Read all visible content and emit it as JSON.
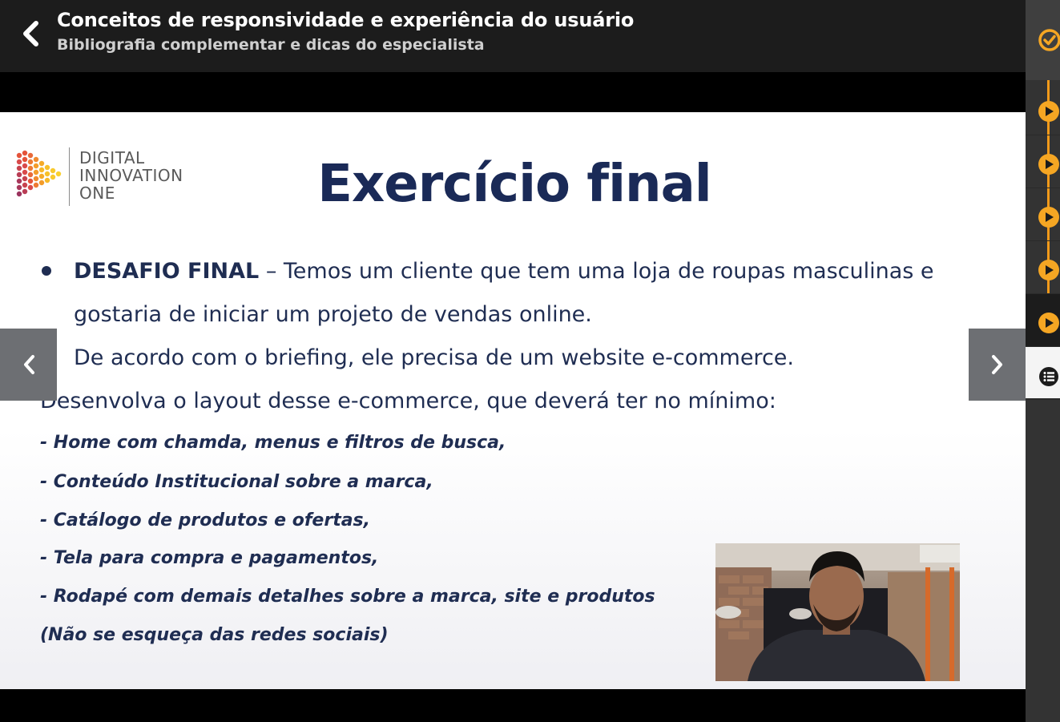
{
  "header": {
    "title": "Conceitos de responsividade e experiência do usuário",
    "subtitle": "Bibliografia complementar e dicas do especialista"
  },
  "slide": {
    "logo_lines": [
      "DIGITAL",
      "INNOVATION",
      "ONE"
    ],
    "title": "Exercício final",
    "bullet_bold": "DESAFIO FINAL",
    "bullet_rest": " – Temos um cliente que tem uma loja de roupas masculinas e",
    "line2": "gostaria de iniciar um projeto de vendas online.",
    "line3": "De acordo com o briefing, ele precisa de um website e-commerce.",
    "line4": "Desenvolva o layout desse e-commerce, que deverá ter no mínimo:",
    "requirements": [
      "- Home com chamda, menus e filtros de busca,",
      "- Conteúdo Institucional sobre a marca,",
      "- Catálogo de produtos e ofertas,",
      "- Tela para compra e pagamentos,",
      "-  Rodapé com demais detalhes sobre a marca, site e produtos",
      "(Não se esqueça das redes sociais)"
    ]
  },
  "icons": {
    "back": "chevron-left-icon",
    "prev": "chevron-left-icon",
    "next": "chevron-right-icon",
    "completed": "check-circle-icon",
    "lesson": "play-circle-icon",
    "list": "list-icon"
  },
  "colors": {
    "accent": "#f29a1a",
    "slide_text": "#1f2d52",
    "header_bg": "#1c1c1c"
  }
}
